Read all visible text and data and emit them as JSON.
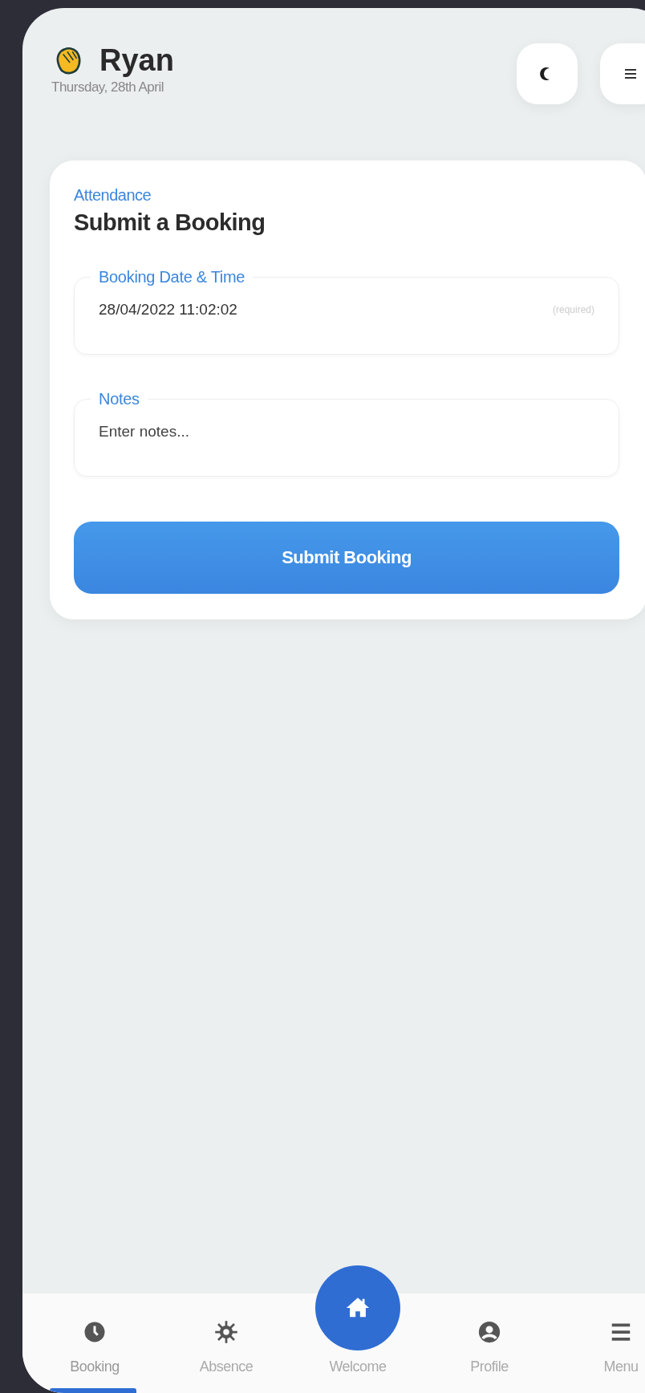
{
  "header": {
    "name": "Ryan",
    "date": "Thursday, 28th April"
  },
  "card": {
    "eyebrow": "Attendance",
    "title": "Submit a Booking",
    "fields": [
      {
        "legend": "Booking Date & Time",
        "value": "28/04/2022 11:02:02",
        "hint": "(required)"
      },
      {
        "legend": "Notes",
        "placeholder": "Enter notes..."
      }
    ],
    "submit": "Submit Booking"
  },
  "nav": [
    {
      "label": "Booking",
      "kind": "clock",
      "selected": true
    },
    {
      "label": "Absence",
      "kind": "sun",
      "selected": false
    },
    {
      "label": "Welcome",
      "kind": "home",
      "selected": false
    },
    {
      "label": "Profile",
      "kind": "user",
      "selected": false
    },
    {
      "label": "Menu",
      "kind": "menu",
      "selected": false
    }
  ]
}
